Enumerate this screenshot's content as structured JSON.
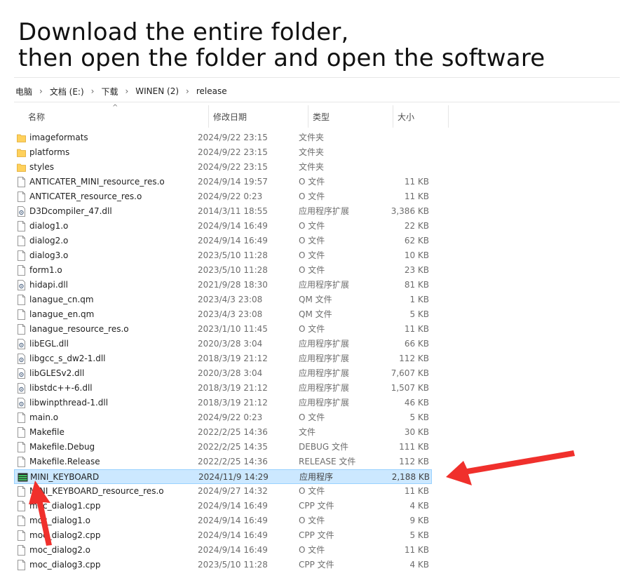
{
  "headline": {
    "line1": "Download the entire folder,",
    "line2": "then open the folder and open the software"
  },
  "breadcrumb": [
    "电脑",
    "文档 (E:)",
    "下载",
    "WINEN (2)",
    "release"
  ],
  "columns": {
    "name": "名称",
    "date": "修改日期",
    "type": "类型",
    "size": "大小"
  },
  "colors": {
    "selected_bg": "#cce8ff",
    "selected_border": "#99d1ff",
    "arrow": "#f0302c",
    "folder": "#ffd15c"
  },
  "files": [
    {
      "name": "imageformats",
      "date": "2024/9/22 23:15",
      "type": "文件夹",
      "size": "",
      "icon": "folder-icon"
    },
    {
      "name": "platforms",
      "date": "2024/9/22 23:15",
      "type": "文件夹",
      "size": "",
      "icon": "folder-icon"
    },
    {
      "name": "styles",
      "date": "2024/9/22 23:15",
      "type": "文件夹",
      "size": "",
      "icon": "folder-icon"
    },
    {
      "name": "ANTICATER_MINI_resource_res.o",
      "date": "2024/9/14 19:57",
      "type": "O 文件",
      "size": "11 KB",
      "icon": "file-icon"
    },
    {
      "name": "ANTICATER_resource_res.o",
      "date": "2024/9/22 0:23",
      "type": "O 文件",
      "size": "11 KB",
      "icon": "file-icon"
    },
    {
      "name": "D3Dcompiler_47.dll",
      "date": "2014/3/11 18:55",
      "type": "应用程序扩展",
      "size": "3,386 KB",
      "icon": "dll-icon"
    },
    {
      "name": "dialog1.o",
      "date": "2024/9/14 16:49",
      "type": "O 文件",
      "size": "22 KB",
      "icon": "file-icon"
    },
    {
      "name": "dialog2.o",
      "date": "2024/9/14 16:49",
      "type": "O 文件",
      "size": "62 KB",
      "icon": "file-icon"
    },
    {
      "name": "dialog3.o",
      "date": "2023/5/10 11:28",
      "type": "O 文件",
      "size": "10 KB",
      "icon": "file-icon"
    },
    {
      "name": "form1.o",
      "date": "2023/5/10 11:28",
      "type": "O 文件",
      "size": "23 KB",
      "icon": "file-icon"
    },
    {
      "name": "hidapi.dll",
      "date": "2021/9/28 18:30",
      "type": "应用程序扩展",
      "size": "81 KB",
      "icon": "dll-icon"
    },
    {
      "name": "lanague_cn.qm",
      "date": "2023/4/3 23:08",
      "type": "QM 文件",
      "size": "1 KB",
      "icon": "file-icon"
    },
    {
      "name": "lanague_en.qm",
      "date": "2023/4/3 23:08",
      "type": "QM 文件",
      "size": "5 KB",
      "icon": "file-icon"
    },
    {
      "name": "lanague_resource_res.o",
      "date": "2023/1/10 11:45",
      "type": "O 文件",
      "size": "11 KB",
      "icon": "file-icon"
    },
    {
      "name": "libEGL.dll",
      "date": "2020/3/28 3:04",
      "type": "应用程序扩展",
      "size": "66 KB",
      "icon": "dll-icon"
    },
    {
      "name": "libgcc_s_dw2-1.dll",
      "date": "2018/3/19 21:12",
      "type": "应用程序扩展",
      "size": "112 KB",
      "icon": "dll-icon"
    },
    {
      "name": "libGLESv2.dll",
      "date": "2020/3/28 3:04",
      "type": "应用程序扩展",
      "size": "7,607 KB",
      "icon": "dll-icon"
    },
    {
      "name": "libstdc++-6.dll",
      "date": "2018/3/19 21:12",
      "type": "应用程序扩展",
      "size": "1,507 KB",
      "icon": "dll-icon"
    },
    {
      "name": "libwinpthread-1.dll",
      "date": "2018/3/19 21:12",
      "type": "应用程序扩展",
      "size": "46 KB",
      "icon": "dll-icon"
    },
    {
      "name": "main.o",
      "date": "2024/9/22 0:23",
      "type": "O 文件",
      "size": "5 KB",
      "icon": "file-icon"
    },
    {
      "name": "Makefile",
      "date": "2022/2/25 14:36",
      "type": "文件",
      "size": "30 KB",
      "icon": "file-icon"
    },
    {
      "name": "Makefile.Debug",
      "date": "2022/2/25 14:35",
      "type": "DEBUG 文件",
      "size": "111 KB",
      "icon": "file-icon"
    },
    {
      "name": "Makefile.Release",
      "date": "2022/2/25 14:36",
      "type": "RELEASE 文件",
      "size": "112 KB",
      "icon": "file-icon"
    },
    {
      "name": "MINI_KEYBOARD",
      "date": "2024/11/9 14:29",
      "type": "应用程序",
      "size": "2,188 KB",
      "icon": "app-icon",
      "selected": true
    },
    {
      "name": "MINI_KEYBOARD_resource_res.o",
      "date": "2024/9/27 14:32",
      "type": "O 文件",
      "size": "11 KB",
      "icon": "file-icon"
    },
    {
      "name": "moc_dialog1.cpp",
      "date": "2024/9/14 16:49",
      "type": "CPP 文件",
      "size": "4 KB",
      "icon": "file-icon"
    },
    {
      "name": "moc_dialog1.o",
      "date": "2024/9/14 16:49",
      "type": "O 文件",
      "size": "9 KB",
      "icon": "file-icon"
    },
    {
      "name": "moc_dialog2.cpp",
      "date": "2024/9/14 16:49",
      "type": "CPP 文件",
      "size": "5 KB",
      "icon": "file-icon"
    },
    {
      "name": "moc_dialog2.o",
      "date": "2024/9/14 16:49",
      "type": "O 文件",
      "size": "11 KB",
      "icon": "file-icon"
    },
    {
      "name": "moc_dialog3.cpp",
      "date": "2023/5/10 11:28",
      "type": "CPP 文件",
      "size": "4 KB",
      "icon": "file-icon"
    }
  ]
}
